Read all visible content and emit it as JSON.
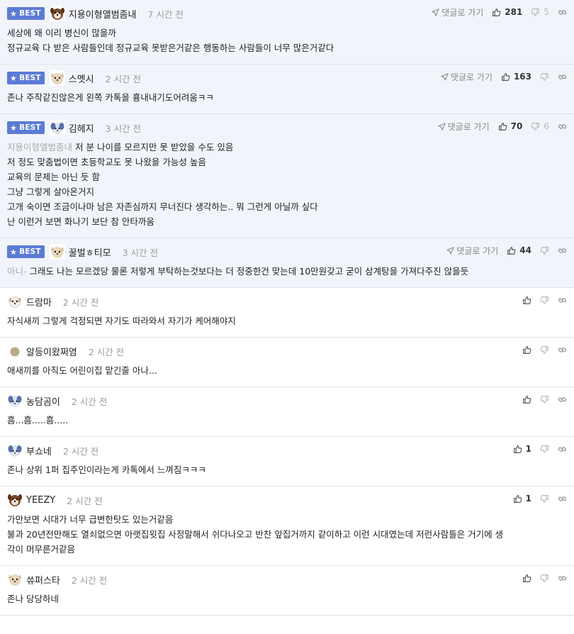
{
  "ui": {
    "best_label": "BEST",
    "reply_label": "댓글로 가기"
  },
  "colors": {
    "best_bg": "#f1f4fa",
    "badge": "#5b7bd5",
    "time": "#999999"
  },
  "comments": [
    {
      "best": true,
      "avatar": "dog-avatar-brown",
      "nickname": "지용이형앨범좀내",
      "time": "7 시간 전",
      "likes": "281",
      "dislikes": "5",
      "mention": "",
      "lines": [
        "세상에 왜 이리 병신이 많을까",
        "정규교육 다 받은 사람들인데 정규교육 못받은거같은 행동하는 사람들이 너무 많은거같다"
      ]
    },
    {
      "best": true,
      "avatar": "dog-avatar-cream",
      "nickname": "스멧시",
      "time": "2 시간 전",
      "likes": "163",
      "dislikes": "",
      "mention": "",
      "lines": [
        "존나 주작같진않은게 왼쪽 카톡을 흉내내기도어려움ㅋㅋ"
      ]
    },
    {
      "best": true,
      "avatar": "dog-avatar-blue",
      "nickname": "김헤지",
      "time": "3 시간 전",
      "likes": "70",
      "dislikes": "6",
      "mention": "지용이형앨범좀내",
      "lines": [
        "저 분 나이를 모르지만 못 받았을 수도 있음",
        "저 정도 맞춤법이면 초등학교도 못 나왔을 가능성 높음",
        "교육의 문제는 아닌 듯 함",
        "그냥 그렇게 살아온거지",
        "고개 숙이면 조금이나마 남은 자존심까지 무너진다 생각하는.. 뭐 그런게 아닐까 싶다",
        "난 이런거 보면 화나기 보단 참 안타까움"
      ]
    },
    {
      "best": true,
      "avatar": "dog-avatar-cream",
      "nickname": "꿀벌ㅎ티모",
      "time": "3 시간 전",
      "likes": "44",
      "dislikes": "",
      "mention": "아니-",
      "lines": [
        "그래도 나는 모르겠당 물론 저렇게 부탁하는것보다는 더 정중한건 맞는데 10만원갖고 굳이 삼계탕을 가져다주진 않을듯"
      ]
    },
    {
      "best": false,
      "avatar": "dog-avatar-white",
      "nickname": "드람마",
      "time": "2 시간 전",
      "likes": "",
      "dislikes": "",
      "mention": "",
      "lines": [
        "자식새끼 그렇게 걱정되면 자기도 따라와서 자기가 케어해야지"
      ]
    },
    {
      "best": false,
      "avatar": "dot-avatar",
      "nickname": "알등이왔쩌염",
      "time": "2 시간 전",
      "likes": "",
      "dislikes": "",
      "mention": "",
      "lines": [
        "애새끼를 아직도 어린이집 맡긴줄 아나..."
      ]
    },
    {
      "best": false,
      "avatar": "dog-avatar-blue",
      "nickname": "농담곰이",
      "time": "2 시간 전",
      "likes": "",
      "dislikes": "",
      "mention": "",
      "lines": [
        "흠...흠.....흠....."
      ]
    },
    {
      "best": false,
      "avatar": "dog-avatar-blue",
      "nickname": "부쇼네",
      "time": "2 시간 전",
      "likes": "1",
      "dislikes": "",
      "mention": "",
      "lines": [
        "존나 상위 1퍼 집주인이라는게 카톡에서 느껴짐ㅋㅋㅋ"
      ]
    },
    {
      "best": false,
      "avatar": "dog-avatar-brown",
      "nickname": "YEEZY",
      "time": "2 시간 전",
      "likes": "1",
      "dislikes": "",
      "mention": "",
      "lines": [
        "가만보면 시대가 너무 급변한탓도 있는거같음",
        "불과 20년전만해도 열쇠없으면 아랫집윗집 사정말해서 쉬다나오고 반찬 앞집거까지 같이하고 이런 시대였는데 저런사람들은 거기에 생",
        "각이 머무른거같음"
      ]
    },
    {
      "best": false,
      "avatar": "dog-avatar-cream",
      "nickname": "쓔퍼스타",
      "time": "2 시간 전",
      "likes": "",
      "dislikes": "",
      "mention": "",
      "lines": [
        "존나 당당하네"
      ]
    }
  ]
}
